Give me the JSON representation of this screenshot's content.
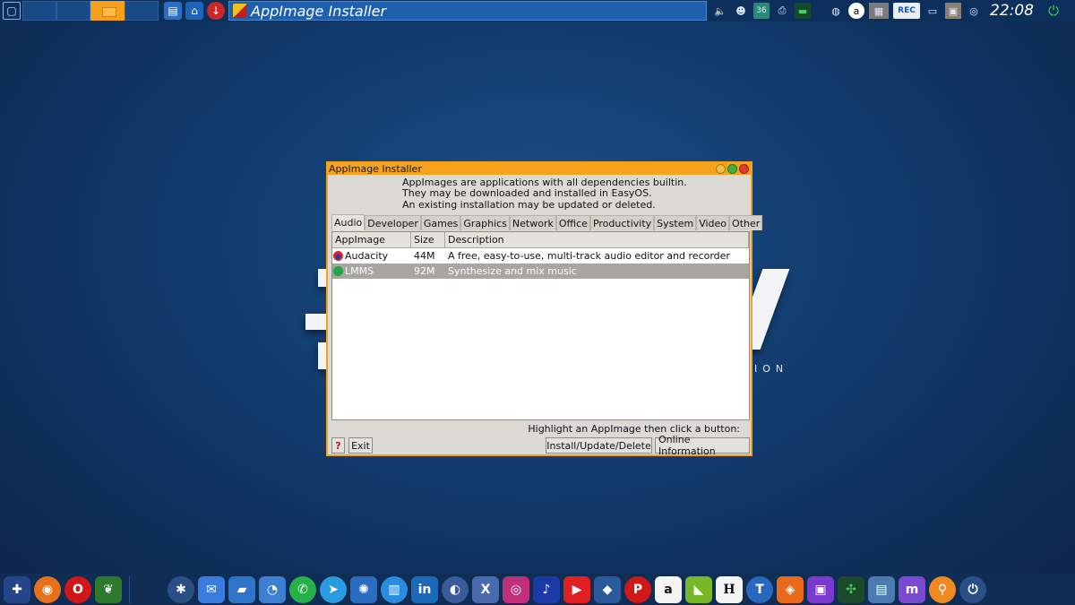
{
  "top_panel": {
    "task_title": "AppImage Installer",
    "clock": "22:08",
    "tray_badges": {
      "temp": "36",
      "rec": "REC"
    }
  },
  "window": {
    "title": "AppImage Installer",
    "intro": [
      "AppImages are applications with all dependencies builtin.",
      "They may be downloaded and installed in EasyOS.",
      "An existing installation may be updated or deleted."
    ],
    "tabs": [
      {
        "label": "Audio",
        "active": true
      },
      {
        "label": "Developer"
      },
      {
        "label": "Games"
      },
      {
        "label": "Graphics"
      },
      {
        "label": "Network"
      },
      {
        "label": "Office"
      },
      {
        "label": "Productivity"
      },
      {
        "label": "System"
      },
      {
        "label": "Video"
      },
      {
        "label": "Other"
      }
    ],
    "columns": [
      "AppImage",
      "Size",
      "Description"
    ],
    "rows": [
      {
        "name": "Audacity",
        "size": "44M",
        "description": "A free, easy-to-use, multi-track audio editor and recorder",
        "selected": false
      },
      {
        "name": "LMMS",
        "size": "92M",
        "description": "Synthesize and mix music",
        "selected": true
      }
    ],
    "hint": "Highlight an AppImage then click a button:",
    "buttons": {
      "help": "?",
      "exit": "Exit",
      "install": "Install/Update/Delete",
      "online": "Online Information"
    }
  },
  "desktop": {
    "logo_tagline": "ION"
  },
  "dock": {
    "icons": [
      "uk-flag-icon",
      "firefox-icon",
      "opera-icon",
      "gecko-icon",
      "star-icon",
      "mail-icon",
      "note-icon",
      "rss-icon",
      "whatsapp-icon",
      "telegram-icon",
      "chatgpt-icon",
      "trash-icon",
      "linkedin-icon",
      "globe-icon",
      "x-icon",
      "instagram-icon",
      "tiktok-icon",
      "youtube-icon",
      "maps-icon",
      "pinterest-icon",
      "amazon-icon",
      "leroymerlin-icon",
      "h-icon",
      "t-icon",
      "gitlab-icon",
      "twitch-icon",
      "network-icon",
      "site-icon",
      "mastodon-icon",
      "location-icon",
      "power-icon"
    ],
    "letters": {
      "linkedin": "in",
      "x": "X",
      "h": "H",
      "t": "T",
      "amazon": "a",
      "pinterest": "P",
      "mastodon": "m"
    }
  },
  "colors": {
    "accent_orange": "#f5a01a",
    "panel_blue": "#0d2f5c",
    "selection_gray": "#a9a6a1",
    "window_bg": "#dcdad5"
  }
}
